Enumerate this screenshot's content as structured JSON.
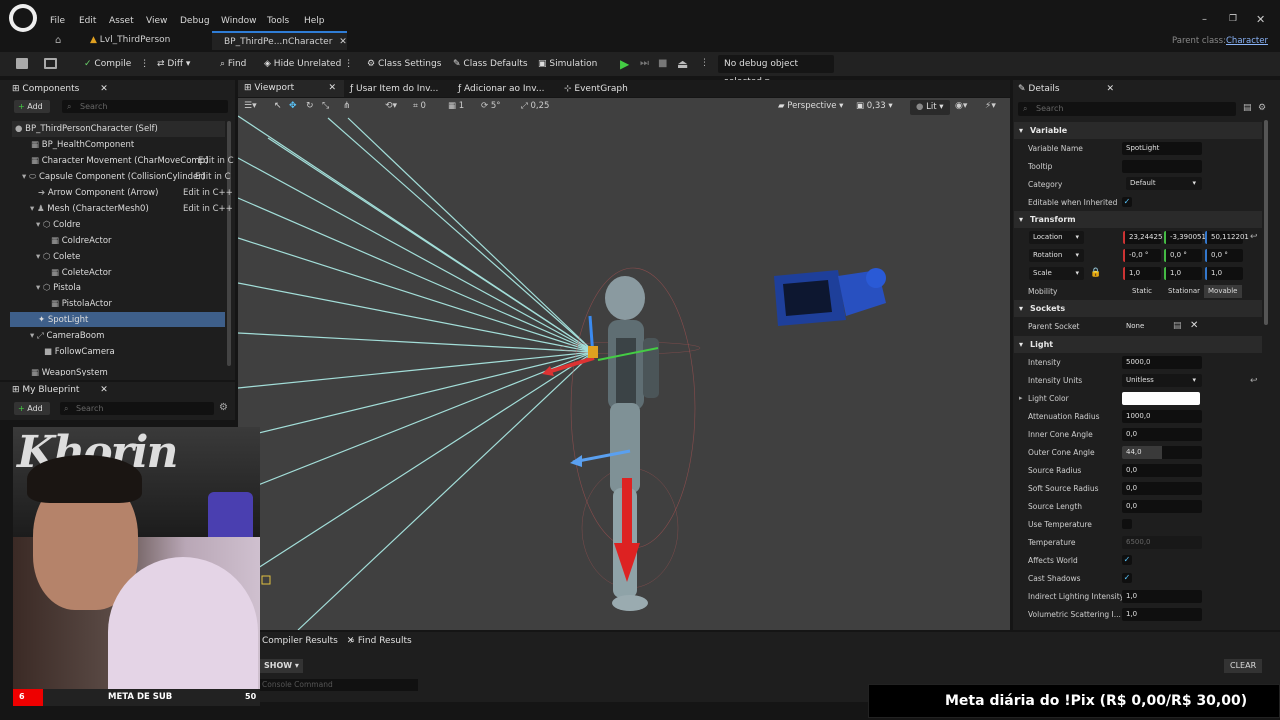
{
  "menu": {
    "items": [
      "File",
      "Edit",
      "Asset",
      "View",
      "Debug",
      "Window",
      "Tools",
      "Help"
    ]
  },
  "tabs": {
    "level": "Lvl_ThirdPerson",
    "blueprint": "BP_ThirdPe...nCharacter",
    "parent_label": "Parent class:",
    "parent_value": "Character"
  },
  "toolbar": {
    "compile": "Compile",
    "diff": "Diff",
    "find": "Find",
    "hide": "Hide Unrelated",
    "class_settings": "Class Settings",
    "class_defaults": "Class Defaults",
    "simulation": "Simulation",
    "debug": "No debug object selected"
  },
  "components": {
    "title": "Components",
    "add": "Add",
    "search": "Search",
    "items": [
      {
        "label": "BP_ThirdPersonCharacter (Self)",
        "edit": ""
      },
      {
        "label": "BP_HealthComponent",
        "edit": ""
      },
      {
        "label": "Character Movement (CharMoveComp)",
        "edit": "Edit in C"
      },
      {
        "label": "Capsule Component (CollisionCylinder)",
        "edit": "Edit in C"
      },
      {
        "label": "Arrow Component (Arrow)",
        "edit": "Edit in C++"
      },
      {
        "label": "Mesh (CharacterMesh0)",
        "edit": "Edit in C++"
      },
      {
        "label": "Coldre",
        "edit": ""
      },
      {
        "label": "ColdreActor",
        "edit": ""
      },
      {
        "label": "Colete",
        "edit": ""
      },
      {
        "label": "ColeteActor",
        "edit": ""
      },
      {
        "label": "Pistola",
        "edit": ""
      },
      {
        "label": "PistolaActor",
        "edit": ""
      },
      {
        "label": "SpotLight",
        "edit": ""
      },
      {
        "label": "CameraBoom",
        "edit": ""
      },
      {
        "label": "FollowCamera",
        "edit": ""
      },
      {
        "label": "WeaponSystem",
        "edit": ""
      }
    ]
  },
  "myblueprint": {
    "title": "My Blueprint",
    "add": "Add",
    "search": "Search"
  },
  "viewport_tabs": [
    "Viewport",
    "Usar Item do Inv...",
    "Adicionar ao Inv...",
    "EventGraph"
  ],
  "viewport_toolbar": {
    "snap1": "0",
    "snap2": "1",
    "snap3": "5°",
    "scale": "0,25",
    "perspective": "Perspective",
    "speed": "0,33",
    "lit": "Lit"
  },
  "bottom": {
    "compiler": "Compiler Results",
    "find": "Find Results",
    "show": "SHOW",
    "console": "Console Command",
    "clear": "CLEAR"
  },
  "details": {
    "title": "Details",
    "search": "Search",
    "variable": {
      "section": "Variable",
      "name_label": "Variable Name",
      "name_value": "SpotLight",
      "tooltip_label": "Tooltip",
      "category_label": "Category",
      "category_value": "Default",
      "editable_label": "Editable when Inherited"
    },
    "transform": {
      "section": "Transform",
      "location": "Location",
      "loc": [
        "23,24425",
        "-3,390051",
        "50,112201"
      ],
      "rotation": "Rotation",
      "rot": [
        "-0,0 °",
        "0,0 °",
        "0,0 °"
      ],
      "scale": "Scale",
      "scl": [
        "1,0",
        "1,0",
        "1,0"
      ],
      "mobility": "Mobility",
      "mob": [
        "Static",
        "Stationar",
        "Movable"
      ]
    },
    "sockets": {
      "section": "Sockets",
      "parent_label": "Parent Socket",
      "parent_value": "None"
    },
    "light": {
      "section": "Light",
      "rows": [
        {
          "label": "Intensity",
          "value": "5000,0"
        },
        {
          "label": "Intensity Units",
          "value": "Unitless"
        },
        {
          "label": "Light Color",
          "value": ""
        },
        {
          "label": "Attenuation Radius",
          "value": "1000,0"
        },
        {
          "label": "Inner Cone Angle",
          "value": "0,0"
        },
        {
          "label": "Outer Cone Angle",
          "value": "44,0"
        },
        {
          "label": "Source Radius",
          "value": "0,0"
        },
        {
          "label": "Soft Source Radius",
          "value": "0,0"
        },
        {
          "label": "Source Length",
          "value": "0,0"
        },
        {
          "label": "Use Temperature",
          "value": ""
        },
        {
          "label": "Temperature",
          "value": "6500,0"
        },
        {
          "label": "Affects World",
          "value": ""
        },
        {
          "label": "Cast Shadows",
          "value": ""
        },
        {
          "label": "Indirect Lighting Intensity",
          "value": "1,0"
        },
        {
          "label": "Volumetric Scattering I...",
          "value": "1,0"
        }
      ]
    }
  },
  "webcam": {
    "brand": "Khorin",
    "meta_left": "6",
    "meta_label": "META DE SUB",
    "meta_right": "50"
  },
  "pix": {
    "text": "Meta diária do !Pix (R$ 0,00/R$ 30,00)"
  },
  "colors": {
    "accent": "#2f7dd6",
    "selected": "#3e5f8a",
    "play": "#44cc44"
  }
}
